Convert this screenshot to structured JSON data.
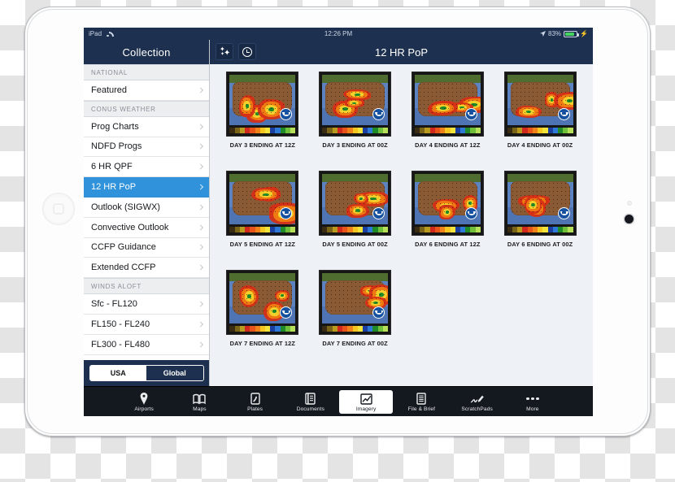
{
  "status_bar": {
    "device_label": "iPad",
    "wifi_icon": "wifi-icon",
    "time": "12:26 PM",
    "location_icon": "location-arrow-icon",
    "battery_percent": "83%",
    "battery_level": 83,
    "charging_icon": "lightning-bolt-icon"
  },
  "sidebar": {
    "title": "Collection",
    "sections": [
      {
        "header": "NATIONAL",
        "items": [
          {
            "label": "Featured",
            "selected": false
          }
        ]
      },
      {
        "header": "CONUS WEATHER",
        "items": [
          {
            "label": "Prog Charts",
            "selected": false
          },
          {
            "label": "NDFD Progs",
            "selected": false
          },
          {
            "label": "6 HR QPF",
            "selected": false
          },
          {
            "label": "12 HR PoP",
            "selected": true
          },
          {
            "label": "Outlook (SIGWX)",
            "selected": false
          },
          {
            "label": "Convective Outlook",
            "selected": false
          },
          {
            "label": "CCFP Guidance",
            "selected": false
          },
          {
            "label": "Extended CCFP",
            "selected": false
          }
        ]
      },
      {
        "header": "WINDS ALOFT",
        "items": [
          {
            "label": "Sfc - FL120",
            "selected": false
          },
          {
            "label": "FL150 - FL240",
            "selected": false
          },
          {
            "label": "FL300 - FL480",
            "selected": false
          }
        ]
      }
    ],
    "footer_segments": [
      {
        "label": "USA",
        "selected": true
      },
      {
        "label": "Global",
        "selected": false
      }
    ]
  },
  "navbar": {
    "title": "12 HR PoP",
    "buttons": [
      {
        "icon": "stars-icon",
        "name": "favorites-button"
      },
      {
        "icon": "clock-icon",
        "name": "recents-button"
      }
    ]
  },
  "grid": {
    "items": [
      {
        "caption": "DAY 3 ENDING AT 12Z"
      },
      {
        "caption": "DAY 3 ENDING AT 00Z"
      },
      {
        "caption": "DAY 4 ENDING AT 12Z"
      },
      {
        "caption": "DAY 4 ENDING AT 00Z"
      },
      {
        "caption": "DAY 5 ENDING AT 12Z"
      },
      {
        "caption": "DAY 5 ENDING AT 00Z"
      },
      {
        "caption": "DAY 6 ENDING AT 12Z"
      },
      {
        "caption": "DAY 6 ENDING AT 00Z"
      },
      {
        "caption": "DAY 7 ENDING AT 12Z"
      },
      {
        "caption": "DAY 7 ENDING AT 00Z"
      }
    ],
    "thumbnail_overlay_icon": "noaa-logo-icon",
    "colorbar_colors": [
      "#3a2c12",
      "#7a6418",
      "#b89a1e",
      "#d0281c",
      "#e8531a",
      "#f0821a",
      "#f4c61f",
      "#f2e43a",
      "#1b3fa0",
      "#2f79d6",
      "#1f8a28",
      "#6fbf3a",
      "#b6e05a"
    ]
  },
  "tabbar": {
    "tabs": [
      {
        "label": "Airports",
        "icon": "airport-tower-icon",
        "active": false
      },
      {
        "label": "Maps",
        "icon": "map-icon",
        "active": false
      },
      {
        "label": "Plates",
        "icon": "plate-document-icon",
        "active": false
      },
      {
        "label": "Documents",
        "icon": "documents-icon",
        "active": false
      },
      {
        "label": "Imagery",
        "icon": "imagery-chart-icon",
        "active": true
      },
      {
        "label": "File & Brief",
        "icon": "file-brief-icon",
        "active": false
      },
      {
        "label": "ScratchPads",
        "icon": "pencil-icon",
        "active": false
      },
      {
        "label": "More",
        "icon": "ellipsis-icon",
        "active": false
      }
    ]
  },
  "device": {
    "home_button": "home-button",
    "camera": "front-camera",
    "sensor": "ambient-light-sensor"
  },
  "colors": {
    "navy": "#1d304f",
    "accent_blue": "#2f92da",
    "tabbar_dark": "#14181f",
    "content_bg": "#eef1f5"
  }
}
